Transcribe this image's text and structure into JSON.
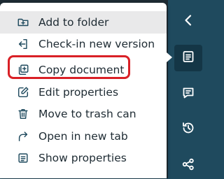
{
  "menu": {
    "items": [
      {
        "label": "Add to folder",
        "icon": "folder-plus-icon"
      },
      {
        "label": "Check-in new version",
        "icon": "check-in-icon"
      },
      {
        "label": "Copy document",
        "icon": "copy-icon"
      },
      {
        "label": "Edit properties",
        "icon": "edit-icon"
      },
      {
        "label": "Move to trash can",
        "icon": "trash-icon"
      },
      {
        "label": "Open in new tab",
        "icon": "open-new-tab-icon"
      },
      {
        "label": "Show properties",
        "icon": "properties-icon"
      }
    ],
    "highlighted_item": "Add to folder",
    "callout_item": "Copy document"
  },
  "rail": {
    "buttons": [
      {
        "icon": "chevron-left-icon"
      },
      {
        "icon": "document-icon",
        "active": true
      },
      {
        "icon": "comment-icon"
      },
      {
        "icon": "history-icon"
      },
      {
        "icon": "share-icon"
      }
    ]
  },
  "colors": {
    "rail_background": "#1f4a5e",
    "rail_active": "#143646",
    "menu_text": "#1e2b33",
    "menu_highlight": "#e9e9ea",
    "callout_border": "#d92026"
  }
}
